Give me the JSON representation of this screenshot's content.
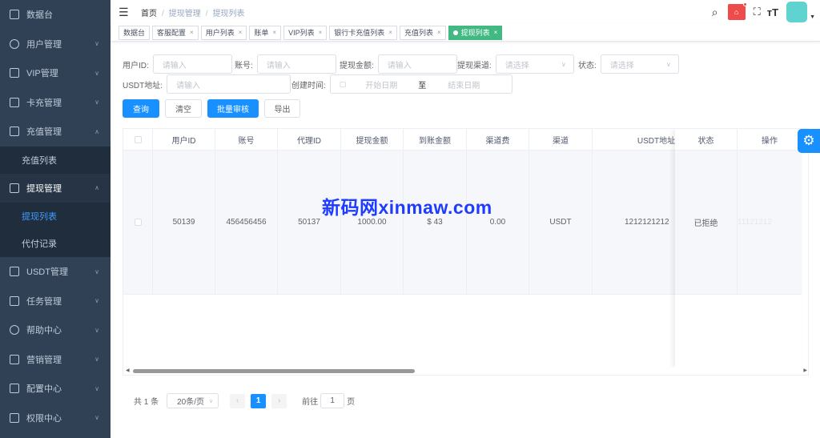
{
  "sidebar": {
    "items": [
      {
        "label": "数据台"
      },
      {
        "label": "用户管理"
      },
      {
        "label": "VIP管理"
      },
      {
        "label": "卡充管理"
      },
      {
        "label": "充值管理"
      },
      {
        "label": "提现管理"
      },
      {
        "label": "USDT管理"
      },
      {
        "label": "任务管理"
      },
      {
        "label": "帮助中心"
      },
      {
        "label": "营销管理"
      },
      {
        "label": "配置中心"
      },
      {
        "label": "权限中心"
      }
    ],
    "sub_recharge": [
      "充值列表"
    ],
    "sub_withdraw": [
      "提现列表",
      "代付记录"
    ]
  },
  "breadcrumb": [
    "首页",
    "提现管理",
    "提现列表"
  ],
  "tags": [
    "数据台",
    "客服配置",
    "用户列表",
    "账单",
    "VIP列表",
    "银行卡充值列表",
    "充值列表",
    "提现列表"
  ],
  "form": {
    "user_id": "用户ID:",
    "account": "账号:",
    "amount": "提现金额:",
    "channel": "提现渠道:",
    "status": "状态:",
    "usdt": "USDT地址:",
    "created": "创建时间:",
    "ph_input": "请输入",
    "ph_select": "请选择",
    "start": "开始日期",
    "to": "至",
    "end": "结束日期"
  },
  "buttons": {
    "query": "查询",
    "clear": "清空",
    "batch": "批量审核",
    "export": "导出"
  },
  "table": {
    "headers": [
      "用户ID",
      "账号",
      "代理ID",
      "提现金额",
      "到账金额",
      "渠道费",
      "渠道",
      "USDT地址",
      "状态",
      "操作"
    ],
    "rows": [
      [
        "50139",
        "456456456",
        "50137",
        "1000.00",
        "$ 43",
        "0.00",
        "USDT",
        "1212121212",
        "已拒绝",
        "11121212"
      ]
    ]
  },
  "pager": {
    "total": "共 1 条",
    "size": "20条/页",
    "page": "1",
    "goto": "前往",
    "goto_val": "1",
    "page_unit": "页"
  },
  "watermark": "新码网xinmaw.com",
  "colors": {
    "primary": "#1890ff",
    "sidebar": "#304156",
    "tag_active": "#42b983"
  }
}
